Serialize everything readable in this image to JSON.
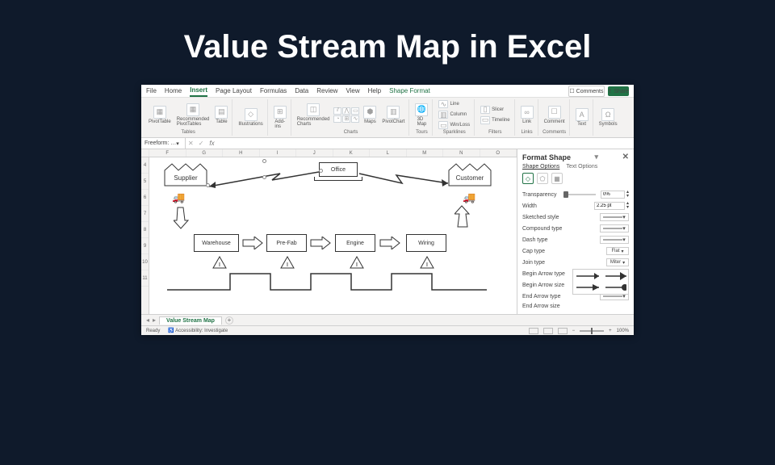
{
  "page_title": "Value Stream Map in Excel",
  "tabs": {
    "file": "File",
    "home": "Home",
    "insert": "Insert",
    "page_layout": "Page Layout",
    "formulas": "Formulas",
    "data": "Data",
    "review": "Review",
    "view": "View",
    "help": "Help",
    "shape_format": "Shape Format"
  },
  "ribbon_right": {
    "comments": "Comments",
    "share": "Share"
  },
  "ribbon_groups": {
    "tables": {
      "label": "Tables",
      "pivot": "PivotTable",
      "rec_pivot": "Recommended\nPivotTables",
      "table": "Table"
    },
    "illustrations": {
      "label": "",
      "btn": "Illustrations"
    },
    "addins": {
      "label": "",
      "btn": "Add-\nins"
    },
    "charts": {
      "label": "Charts",
      "rec": "Recommended\nCharts",
      "maps": "Maps",
      "pivotchart": "PivotChart"
    },
    "tours": {
      "label": "Tours",
      "btn": "3D\nMap"
    },
    "sparklines": {
      "label": "Sparklines",
      "line": "Line",
      "col": "Column",
      "winloss": "Win/Loss"
    },
    "filters": {
      "label": "Filters",
      "slicer": "Slicer",
      "timeline": "Timeline"
    },
    "links": {
      "label": "Links",
      "btn": "Link"
    },
    "comments": {
      "label": "Comments",
      "btn": "Comment"
    },
    "text": {
      "label": "",
      "btn": "Text"
    },
    "symbols": {
      "label": "",
      "btn": "Symbols"
    }
  },
  "name_box": "Freeform: …",
  "columns": [
    "F",
    "G",
    "H",
    "I",
    "J",
    "K",
    "L",
    "M",
    "N",
    "O"
  ],
  "rows": [
    "4",
    "5",
    "6",
    "7",
    "8",
    "9",
    "10",
    "11"
  ],
  "vsm": {
    "supplier": "Supplier",
    "office": "Office",
    "customer": "Customer",
    "warehouse": "Warehouse",
    "prefab": "Pre-Fab",
    "engine": "Engine",
    "wiring": "Wiring",
    "inv": "I"
  },
  "fmt": {
    "title": "Format Shape",
    "shape_opts": "Shape Options",
    "text_opts": "Text Options",
    "transparency": "Transparency",
    "trans_val": "0%",
    "width": "Width",
    "width_val": "2.25 pt",
    "sketched": "Sketched style",
    "compound": "Compound type",
    "dash": "Dash type",
    "cap": "Cap type",
    "cap_val": "Flat",
    "join": "Join type",
    "join_val": "Miter",
    "begin_arrow_t": "Begin Arrow type",
    "begin_arrow_s": "Begin Arrow size",
    "end_arrow_t": "End Arrow type",
    "end_arrow_s": "End Arrow size"
  },
  "sheet_tab": "Value Stream Map",
  "status": {
    "ready": "Ready",
    "access": "Accessibility: Investigate",
    "zoom": "100%"
  }
}
